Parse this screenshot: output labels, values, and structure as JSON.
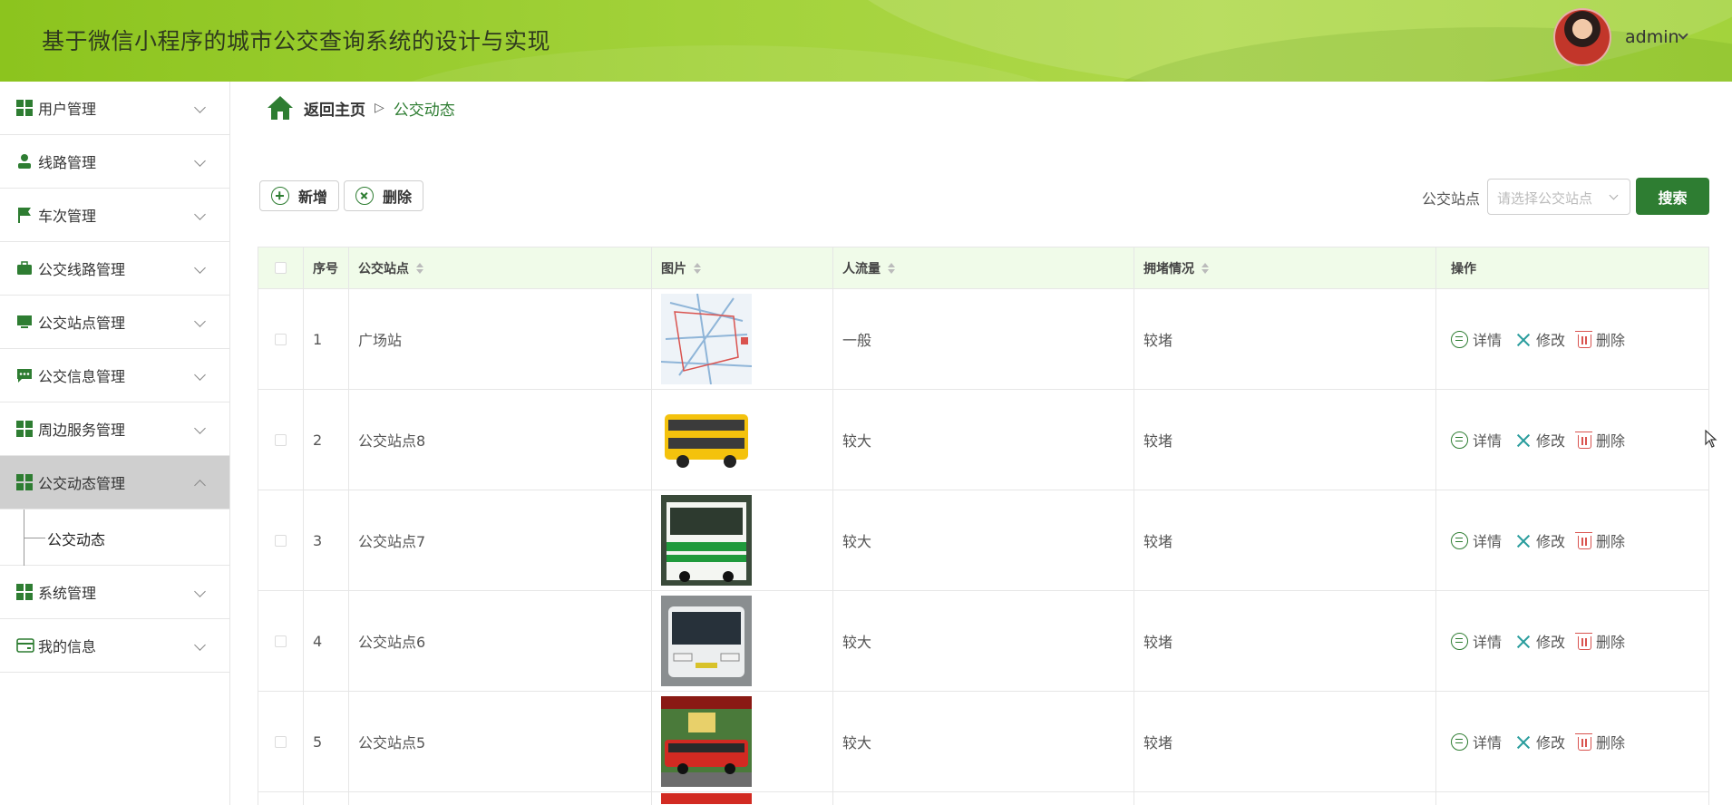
{
  "header": {
    "title": "基于微信小程序的城市公交查询系统的设计与实现",
    "user": "admin"
  },
  "sidebar": {
    "items": [
      {
        "label": "用户管理",
        "icon": "grid-icon"
      },
      {
        "label": "线路管理",
        "icon": "user-icon"
      },
      {
        "label": "车次管理",
        "icon": "flag-icon"
      },
      {
        "label": "公交线路管理",
        "icon": "briefcase-icon"
      },
      {
        "label": "公交站点管理",
        "icon": "monitor-icon"
      },
      {
        "label": "公交信息管理",
        "icon": "chat-icon"
      },
      {
        "label": "周边服务管理",
        "icon": "grid-icon"
      },
      {
        "label": "公交动态管理",
        "icon": "grid-icon"
      },
      {
        "label": "系统管理",
        "icon": "grid-icon"
      },
      {
        "label": "我的信息",
        "icon": "card-icon"
      }
    ],
    "submenu": {
      "label": "公交动态"
    }
  },
  "breadcrumb": {
    "home": "返回主页",
    "separator": "▷",
    "current": "公交动态"
  },
  "toolbar": {
    "add_label": "新增",
    "delete_label": "删除"
  },
  "search": {
    "label": "公交站点",
    "placeholder": "请选择公交站点",
    "button": "搜索"
  },
  "table": {
    "columns": [
      "序号",
      "公交站点",
      "图片",
      "人流量",
      "拥堵情况",
      "操作"
    ],
    "actions": {
      "detail": "详情",
      "edit": "修改",
      "delete": "删除"
    },
    "rows": [
      {
        "index": "1",
        "station": "广场站",
        "image": "map-thumbnail",
        "flow": "一般",
        "congestion": "较堵"
      },
      {
        "index": "2",
        "station": "公交站点8",
        "image": "yellow-double-decker-bus",
        "flow": "较大",
        "congestion": "较堵"
      },
      {
        "index": "3",
        "station": "公交站点7",
        "image": "green-white-bus",
        "flow": "较大",
        "congestion": "较堵"
      },
      {
        "index": "4",
        "station": "公交站点6",
        "image": "white-city-bus",
        "flow": "较大",
        "congestion": "较堵"
      },
      {
        "index": "5",
        "station": "公交站点5",
        "image": "red-bus",
        "flow": "较大",
        "congestion": "较堵"
      }
    ]
  },
  "colors": {
    "primary": "#2e7d32",
    "header": "#a2d23a",
    "thead": "#f0fbe9",
    "edit": "#2a9d9d",
    "danger": "#d9534f"
  }
}
